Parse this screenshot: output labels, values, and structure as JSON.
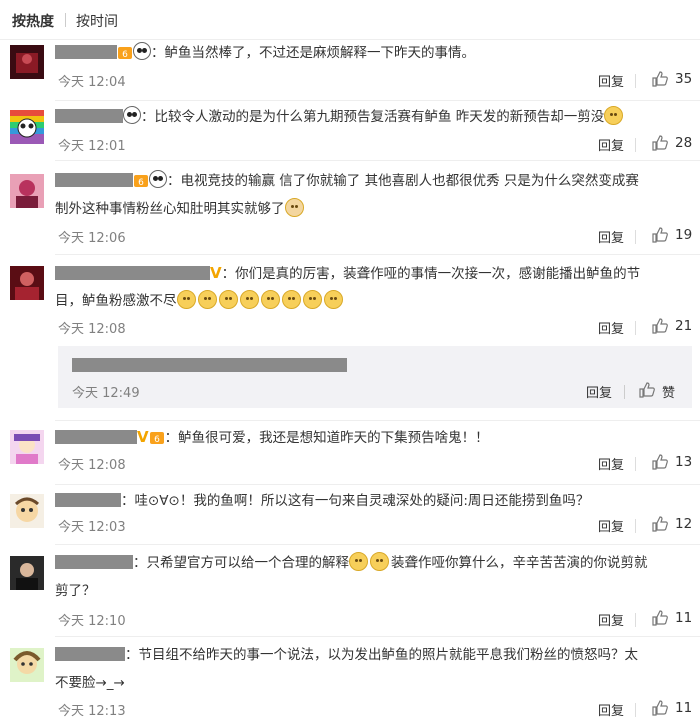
{
  "sort": {
    "by_hot": "按热度",
    "by_time": "按时间"
  },
  "actions": {
    "reply": "回复",
    "like_word": "赞"
  },
  "comments": [
    {
      "text": "：鲈鱼当然棒了，不过还是麻烦解释一下昨天的事情。",
      "time": "今天 12:04",
      "likes": "35"
    },
    {
      "text": "：比较令人激动的是为什么第九期预告复活赛有鲈鱼 昨天发的新预告却一剪没",
      "time": "今天 12:01",
      "likes": "28"
    },
    {
      "text1": "：电视竞技的输赢 信了你就输了 其他喜剧人也都很优秀 只是为什么突然变成赛",
      "text2": "制外这种事情粉丝心知肚明其实就够了",
      "time": "今天 12:06",
      "likes": "19"
    },
    {
      "text1": "：你们是真的厉害，装聋作哑的事情一次接一次，感谢能播出鲈鱼的节",
      "text2": "目，鲈鱼粉感激不尽",
      "time": "今天 12:08",
      "likes": "21"
    },
    {
      "text": "：鲈鱼很可爱，我还是想知道昨天的下集预告啥鬼！！",
      "time": "今天 12:08",
      "likes": "13"
    },
    {
      "text": "：哇⊙∀⊙！我的鱼啊！所以这有一句来自灵魂深处的疑问:周日还能捞到鱼吗？",
      "time": "今天 12:03",
      "likes": "12"
    },
    {
      "text1a": "：只希望官方可以给一个合理的解释",
      "text1b": "装聋作哑你算什么，辛辛苦苦演的你说剪就",
      "text2": "剪了？",
      "time": "今天 12:10",
      "likes": "11"
    },
    {
      "text1": "：节目组不给昨天的事一个说法，以为发出鲈鱼的照片就能平息我们粉丝的愤怒吗？太",
      "text2": "不要脸→_→",
      "time": "今天 12:13",
      "likes": "11"
    }
  ],
  "sub_reply": {
    "time": "今天 12:49"
  },
  "icons": {
    "like": "thumbs-up-icon",
    "emoji": "smiley-emoji-icon",
    "panda": "panda-emoji-icon",
    "vip": "vip-crown-icon",
    "verified": "verified-v-icon"
  },
  "colors": {
    "text": "#333333",
    "meta": "#808080",
    "reply_bg": "#f2f2f5",
    "verified": "#f3a500"
  }
}
